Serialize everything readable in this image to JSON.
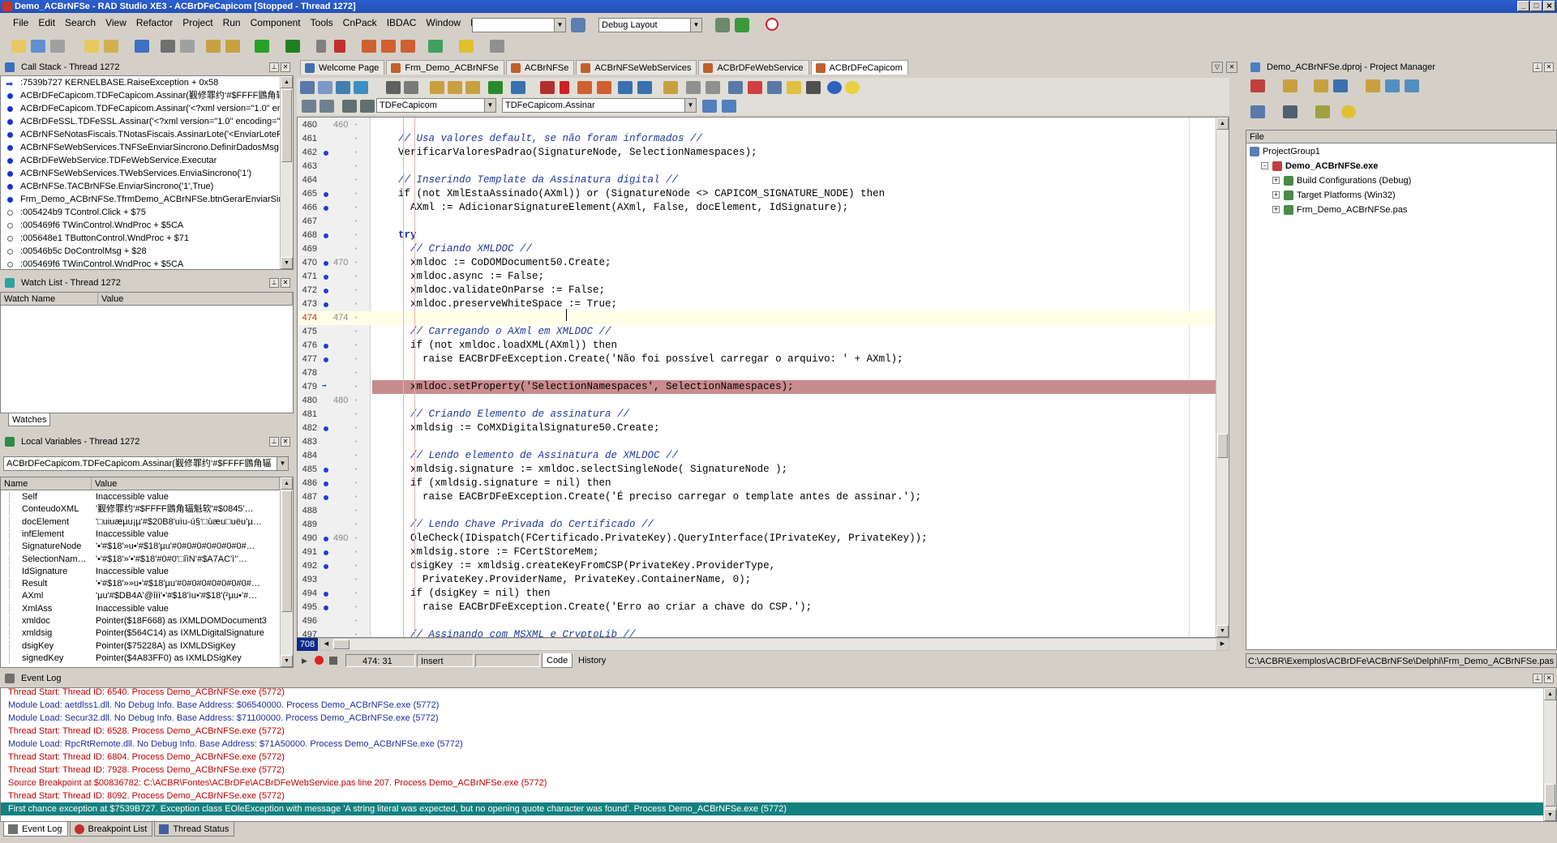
{
  "window": {
    "title": "Demo_ACBrNFSe - RAD Studio XE3 - ACBrDFeCapicom [Stopped - Thread 1272]",
    "buttons": [
      "_",
      "□",
      "✕"
    ]
  },
  "menu": {
    "items": [
      "File",
      "Edit",
      "Search",
      "View",
      "Refactor",
      "Project",
      "Run",
      "Component",
      "Tools",
      "CnPack",
      "IBDAC",
      "Window",
      "Help"
    ],
    "combo1_value": "",
    "layout_combo_value": "Debug Layout"
  },
  "call_stack": {
    "title": "Call Stack - Thread 1272",
    "rows": [
      {
        "text": ":7539b727 KERNELBASE.RaiseException + 0x58",
        "marker": "arrow"
      },
      {
        "text": "ACBrDFeCapicom.TDFeCapicom.Assinar(觐修罪约‘#$FFFF鵾角辐’幾串’",
        "marker": "dot"
      },
      {
        "text": "ACBrDFeCapicom.TDFeCapicom.Assinar('<?xml version=\"1.0\" enc",
        "marker": "dot"
      },
      {
        "text": "ACBrDFeSSL.TDFeSSL.Assinar('<?xml version=\"1.0\" encoding=\"U",
        "marker": "dot"
      },
      {
        "text": "ACBrNFSeNotasFiscais.TNotasFiscais.AssinarLote('<EnviarLoteRp",
        "marker": "dot"
      },
      {
        "text": "ACBrNFSeWebServices.TNFSeEnviarSincrono.DefinirDadosMsg",
        "marker": "dot"
      },
      {
        "text": "ACBrDFeWebService.TDFeWebService.Executar",
        "marker": "dot"
      },
      {
        "text": "ACBrNFSeWebServices.TWebServices.EnviaSincrono('1')",
        "marker": "dot"
      },
      {
        "text": "ACBrNFSe.TACBrNFSe.EnviarSincrono('1',True)",
        "marker": "dot"
      },
      {
        "text": "Frm_Demo_ACBrNFSe.TfrmDemo_ACBrNFSe.btnGerarEnviarSincr",
        "marker": "dot"
      },
      {
        "text": ":005424b9 TControl.Click + $75",
        "marker": "hollow"
      },
      {
        "text": ":005469f6 TWinControl.WndProc + $5CA",
        "marker": "hollow"
      },
      {
        "text": ":005648e1 TButtonControl.WndProc + $71",
        "marker": "hollow"
      },
      {
        "text": ":00546b5c DoControlMsg + $28",
        "marker": "hollow"
      },
      {
        "text": ":005469f6 TWinControl.WndProc + $5CA",
        "marker": "hollow"
      }
    ]
  },
  "watch_list": {
    "title": "Watch List - Thread 1272",
    "columns": [
      "Watch Name",
      "Value"
    ],
    "tab": "Watches"
  },
  "local_vars": {
    "title": "Local Variables - Thread 1272",
    "combo_value": "ACBrDFeCapicom.TDFeCapicom.Assinar(觐修罪约‘#$FFFF鵾角辐",
    "columns": [
      "Name",
      "Value"
    ],
    "rows": [
      {
        "name": "Self",
        "value": "Inaccessible value"
      },
      {
        "name": "ConteudoXML",
        "value": "'觐修罪约‘#$FFFF鵾角辐魁软'#$0845'…"
      },
      {
        "name": "docElement",
        "value": "'□uiuæµu¡µ'#$20B8'uìu-ú§‘□ùæu□uëu’µ…"
      },
      {
        "name": "infElement",
        "value": "Inaccessible value"
      },
      {
        "name": "SignatureNode",
        "value": "'•'#$18'»u•'#$18'µu'#0#0#0#0#0#0#0#…"
      },
      {
        "name": "SelectionNam…",
        "value": "'•'#$18'»'•'#$18'#0#0'□îìN’#$A7AC'ì’’…"
      },
      {
        "name": "IdSignature",
        "value": "Inaccessible value"
      },
      {
        "name": "Result",
        "value": "'•'#$18'»»u•'#$18'µu'#0#0#0#0#0#0#0#…"
      },
      {
        "name": "AXml",
        "value": "'µu'#$DB4A'@îìì'•'#$18'ìu•'#$18'(²µu•'#…"
      },
      {
        "name": "XmlAss",
        "value": "Inaccessible value"
      },
      {
        "name": "xmldoc",
        "value": "Pointer($18F668) as IXMLDOMDocument3"
      },
      {
        "name": "xmldsig",
        "value": "Pointer($564C14) as IXMLDigitalSignature"
      },
      {
        "name": "dsigKey",
        "value": "Pointer($75228A) as IXMLDSigKey"
      },
      {
        "name": "signedKey",
        "value": "Pointer($4A83FF0) as IXMLDSigKey"
      }
    ]
  },
  "editor": {
    "tabs": [
      {
        "label": "Welcome Page",
        "active": false
      },
      {
        "label": "Frm_Demo_ACBrNFSe",
        "active": false
      },
      {
        "label": "ACBrNFSe",
        "active": false
      },
      {
        "label": "ACBrNFSeWebServices",
        "active": false
      },
      {
        "label": "ACBrDFeWebService",
        "active": false
      },
      {
        "label": "ACBrDFeCapicom",
        "active": true
      }
    ],
    "class_combo": "TDFeCapicom",
    "method_combo": "TDFeCapicom.Assinar",
    "lines": [
      {
        "n": "460",
        "n2": "460",
        "dot": false,
        "code": "",
        "type": "blank"
      },
      {
        "n": "461",
        "n2": "",
        "dot": false,
        "code": "// Usa valores default, se não foram informados //",
        "type": "comment",
        "indent": 2
      },
      {
        "n": "462",
        "n2": "",
        "dot": true,
        "code": "VerificarValoresPadrao(SignatureNode, SelectionNamespaces);",
        "type": "code",
        "indent": 2
      },
      {
        "n": "463",
        "n2": "",
        "dot": false,
        "code": "",
        "type": "blank"
      },
      {
        "n": "464",
        "n2": "",
        "dot": false,
        "code": "// Inserindo Template da Assinatura digital //",
        "type": "comment",
        "indent": 2
      },
      {
        "n": "465",
        "n2": "",
        "dot": true,
        "code": "if (not XmlEstaAssinado(AXml)) or (SignatureNode <> CAPICOM_SIGNATURE_NODE) then",
        "type": "code",
        "indent": 2
      },
      {
        "n": "466",
        "n2": "",
        "dot": true,
        "code": "  AXml := AdicionarSignatureElement(AXml, False, docElement, IdSignature);",
        "type": "code",
        "indent": 2
      },
      {
        "n": "467",
        "n2": "",
        "dot": false,
        "code": "",
        "type": "blank"
      },
      {
        "n": "468",
        "n2": "",
        "dot": true,
        "code": "try",
        "type": "kw",
        "indent": 2
      },
      {
        "n": "469",
        "n2": "",
        "dot": false,
        "code": "  // Criando XMLDOC //",
        "type": "comment",
        "indent": 2
      },
      {
        "n": "470",
        "n2": "470",
        "dot": true,
        "code": "  xmldoc := CoDOMDocument50.Create;",
        "type": "code",
        "indent": 2
      },
      {
        "n": "471",
        "n2": "",
        "dot": true,
        "code": "  xmldoc.async := False;",
        "type": "code",
        "indent": 2
      },
      {
        "n": "472",
        "n2": "",
        "dot": true,
        "code": "  xmldoc.validateOnParse := False;",
        "type": "code",
        "indent": 2
      },
      {
        "n": "473",
        "n2": "",
        "dot": true,
        "code": "  xmldoc.preserveWhiteSpace := True;",
        "type": "code",
        "indent": 2
      },
      {
        "n": "474",
        "n2": "474",
        "dot": false,
        "code": "",
        "type": "current"
      },
      {
        "n": "475",
        "n2": "",
        "dot": false,
        "code": "  // Carregando o AXml em XMLDOC //",
        "type": "comment",
        "indent": 2
      },
      {
        "n": "476",
        "n2": "",
        "dot": true,
        "code": "  if (not xmldoc.loadXML(AXml)) then",
        "type": "code",
        "indent": 2
      },
      {
        "n": "477",
        "n2": "",
        "dot": true,
        "code": "    raise EACBrDFeException.Create('Não foi possível carregar o arquivo: ' + AXml);",
        "type": "code",
        "indent": 2
      },
      {
        "n": "478",
        "n2": "",
        "dot": false,
        "code": "",
        "type": "blank"
      },
      {
        "n": "479",
        "n2": "",
        "dot": true,
        "code": "  xmldoc.setProperty('SelectionNamespaces', SelectionNamespaces);",
        "type": "breakpoint",
        "indent": 2
      },
      {
        "n": "480",
        "n2": "480",
        "dot": false,
        "code": "",
        "type": "blank"
      },
      {
        "n": "481",
        "n2": "",
        "dot": false,
        "code": "  // Criando Elemento de assinatura //",
        "type": "comment",
        "indent": 2
      },
      {
        "n": "482",
        "n2": "",
        "dot": true,
        "code": "  xmldsig := CoMXDigitalSignature50.Create;",
        "type": "code",
        "indent": 2
      },
      {
        "n": "483",
        "n2": "",
        "dot": false,
        "code": "",
        "type": "blank"
      },
      {
        "n": "484",
        "n2": "",
        "dot": false,
        "code": "  // Lendo elemento de Assinatura de XMLDOC //",
        "type": "comment",
        "indent": 2
      },
      {
        "n": "485",
        "n2": "",
        "dot": true,
        "code": "  xmldsig.signature := xmldoc.selectSingleNode( SignatureNode );",
        "type": "code",
        "indent": 2
      },
      {
        "n": "486",
        "n2": "",
        "dot": true,
        "code": "  if (xmldsig.signature = nil) then",
        "type": "code",
        "indent": 2
      },
      {
        "n": "487",
        "n2": "",
        "dot": true,
        "code": "    raise EACBrDFeException.Create('É preciso carregar o template antes de assinar.');",
        "type": "code",
        "indent": 2
      },
      {
        "n": "488",
        "n2": "",
        "dot": false,
        "code": "",
        "type": "blank"
      },
      {
        "n": "489",
        "n2": "",
        "dot": false,
        "code": "  // Lendo Chave Privada do Certificado //",
        "type": "comment",
        "indent": 2
      },
      {
        "n": "490",
        "n2": "490",
        "dot": true,
        "code": "  OleCheck(IDispatch(FCertificado.PrivateKey).QueryInterface(IPrivateKey, PrivateKey));",
        "type": "code",
        "indent": 2
      },
      {
        "n": "491",
        "n2": "",
        "dot": true,
        "code": "  xmldsig.store := FCertStoreMem;",
        "type": "code",
        "indent": 2
      },
      {
        "n": "492",
        "n2": "",
        "dot": true,
        "code": "  dsigKey := xmldsig.createKeyFromCSP(PrivateKey.ProviderType,",
        "type": "code",
        "indent": 2
      },
      {
        "n": "493",
        "n2": "",
        "dot": false,
        "code": "    PrivateKey.ProviderName, PrivateKey.ContainerName, 0);",
        "type": "code",
        "indent": 2
      },
      {
        "n": "494",
        "n2": "",
        "dot": true,
        "code": "  if (dsigKey = nil) then",
        "type": "code",
        "indent": 2
      },
      {
        "n": "495",
        "n2": "",
        "dot": true,
        "code": "    raise EACBrDFeException.Create('Erro ao criar a chave do CSP.');",
        "type": "code",
        "indent": 2
      },
      {
        "n": "496",
        "n2": "",
        "dot": false,
        "code": "",
        "type": "blank"
      },
      {
        "n": "497",
        "n2": "",
        "dot": false,
        "code": "  // Assinando com MSXML e CryptoLib //",
        "type": "comment",
        "indent": 2
      }
    ],
    "footer_line": "708",
    "status": {
      "position": "474: 31",
      "mode": "Insert",
      "tab_code": "Code",
      "tab_history": "History"
    }
  },
  "project_manager": {
    "title": "Demo_ACBrNFSe.dproj - Project Manager",
    "column": "File",
    "tree": [
      {
        "label": "ProjectGroup1",
        "level": 0,
        "bold": false,
        "expander": ""
      },
      {
        "label": "Demo_ACBrNFSe.exe",
        "level": 1,
        "bold": true,
        "expander": "-"
      },
      {
        "label": "Build Configurations (Debug)",
        "level": 2,
        "bold": false,
        "expander": "+"
      },
      {
        "label": "Target Platforms (Win32)",
        "level": 2,
        "bold": false,
        "expander": "+"
      },
      {
        "label": "Frm_Demo_ACBrNFSe.pas",
        "level": 2,
        "bold": false,
        "expander": "+"
      }
    ],
    "path": "C:\\ACBR\\Exemplos\\ACBrDFe\\ACBrNFSe\\Delphi\\Frm_Demo_ACBrNFSe.pas"
  },
  "event_log": {
    "title": "Event Log",
    "rows": [
      {
        "text": "Thread Start: Thread ID: 6540. Process Demo_ACBrNFSe.exe (5772)",
        "color": "red"
      },
      {
        "text": "Module Load: aetdlss1.dll. No Debug Info. Base Address: $06540000. Process Demo_ACBrNFSe.exe (5772)",
        "color": "blue"
      },
      {
        "text": "Module Load: Secur32.dll. No Debug Info. Base Address: $71100000. Process Demo_ACBrNFSe.exe (5772)",
        "color": "blue"
      },
      {
        "text": "Thread Start: Thread ID: 6528. Process Demo_ACBrNFSe.exe (5772)",
        "color": "red"
      },
      {
        "text": "Module Load: RpcRtRemote.dll. No Debug Info. Base Address: $71A50000. Process Demo_ACBrNFSe.exe (5772)",
        "color": "blue"
      },
      {
        "text": "Thread Start: Thread ID: 6804. Process Demo_ACBrNFSe.exe (5772)",
        "color": "red"
      },
      {
        "text": "Thread Start: Thread ID: 7928. Process Demo_ACBrNFSe.exe (5772)",
        "color": "red"
      },
      {
        "text": "Source Breakpoint at $00836782: C:\\ACBR\\Fontes\\ACBrDFe\\ACBrDFeWebService.pas line 207. Process Demo_ACBrNFSe.exe (5772)",
        "color": "red"
      },
      {
        "text": "Thread Start: Thread ID: 8092. Process Demo_ACBrNFSe.exe (5772)",
        "color": "red"
      },
      {
        "text": "First chance exception at $7539B727. Exception class EOleException with message 'A string literal was expected, but no opening quote character was found'. Process Demo_ACBrNFSe.exe (5772)",
        "color": "sel"
      }
    ],
    "tabs": [
      "Event Log",
      "Breakpoint List",
      "Thread Status"
    ]
  }
}
